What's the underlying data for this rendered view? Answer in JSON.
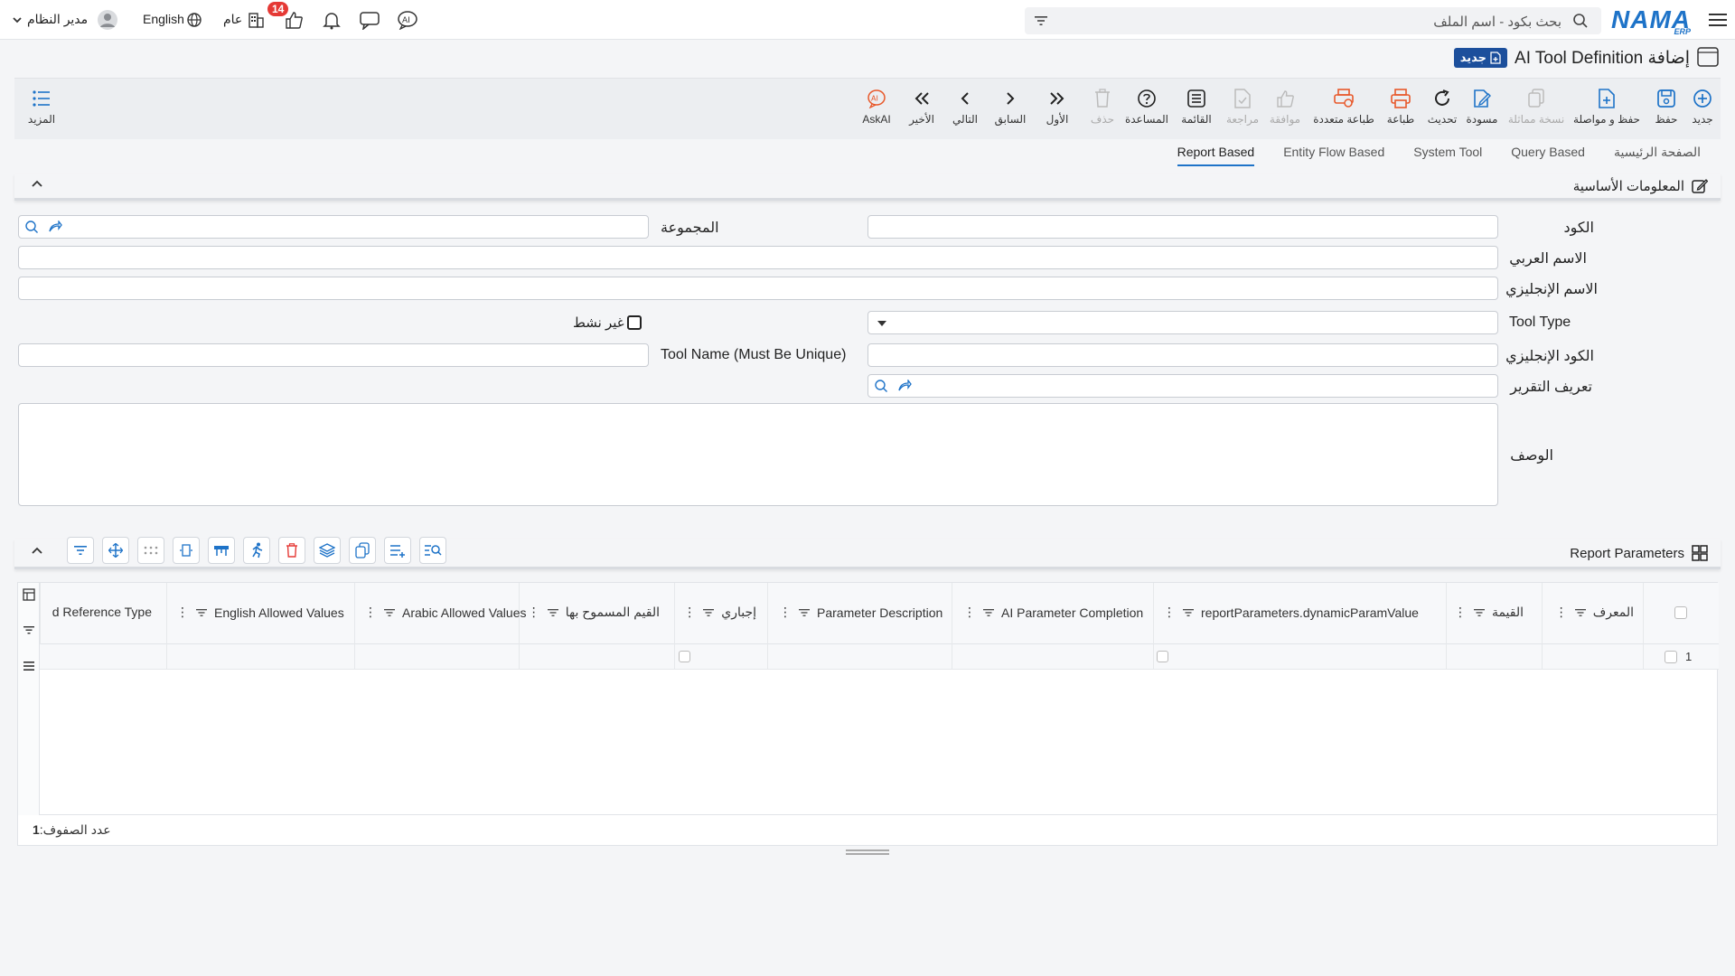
{
  "topbar": {
    "logo_text": "NAMA",
    "logo_sub": "ERP",
    "search_placeholder": "بحث بكود - اسم الملف",
    "user_name": "مدير النظام",
    "language": "English",
    "general_label": "عام",
    "notification_count": "14"
  },
  "title": {
    "text": "إضافة AI Tool Definition",
    "badge": "جديد"
  },
  "toolbar": {
    "new": "جديد",
    "save": "حفظ",
    "save_continue": "حفظ و مواصلة",
    "duplicate": "نسخة مماثلة",
    "draft": "مسودة",
    "refresh": "تحديث",
    "print": "طباعة",
    "multi_print": "طباعة متعددة",
    "approve": "موافقة",
    "review": "مراجعة",
    "list": "القائمة",
    "help": "المساعدة",
    "delete": "حذف",
    "first": "الأول",
    "previous": "السابق",
    "next": "التالي",
    "last": "الأخير",
    "askai": "AskAI",
    "more": "المزيد"
  },
  "tabs": [
    "الصفحة الرئيسية",
    "Query Based",
    "System Tool",
    "Entity Flow Based",
    "Report Based"
  ],
  "active_tab": "Report Based",
  "basic_section": {
    "title": "المعلومات الأساسية"
  },
  "form": {
    "code_label": "الكود",
    "group_label": "المجموعة",
    "arabic_name_label": "الاسم العربي",
    "english_name_label": "الاسم الإنجليزي",
    "tool_type_label": "Tool Type",
    "inactive_label": "غير نشط",
    "english_code_label": "الكود الإنجليزي",
    "tool_name_label": "Tool Name (Must Be Unique)",
    "report_def_label": "تعريف التقرير",
    "description_label": "الوصف"
  },
  "params_section": {
    "title": "Report Parameters"
  },
  "grid": {
    "columns": [
      "المعرف",
      "القيمة",
      "reportParameters.dynamicParamValue",
      "AI Parameter Completion",
      "Parameter Description",
      "إجباري",
      "القيم المسموح بها",
      "Arabic Allowed Values",
      "English Allowed Values",
      "d Reference Type"
    ],
    "rows": [
      {
        "index": "1"
      }
    ],
    "row_count_label": "عدد الصفوف:",
    "row_count": "1"
  },
  "colors": {
    "brand": "#1e73c8",
    "badge": "#1c4f9c",
    "notify": "#e53935",
    "print_orange": "#e8582a"
  }
}
